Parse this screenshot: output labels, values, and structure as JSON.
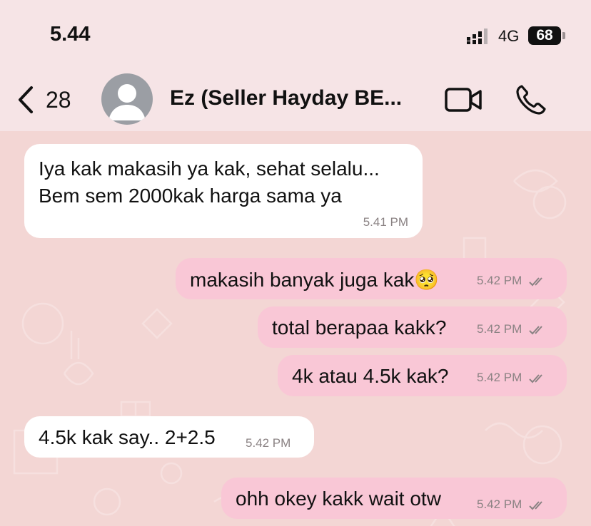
{
  "status_bar": {
    "time": "5.44",
    "network": "4G",
    "battery": "68"
  },
  "header": {
    "back_count": "28",
    "contact_name": "Ez (Seller Hayday BE..."
  },
  "messages": [
    {
      "direction": "in",
      "lines": [
        "Iya kak makasih ya kak, sehat selalu...",
        "Bem sem 2000kak harga sama ya"
      ],
      "time": "5.41 PM"
    },
    {
      "direction": "out",
      "text": "makasih banyak juga kak🥺",
      "time": "5.42 PM",
      "read": true
    },
    {
      "direction": "out",
      "text": "total berapaa kakk?",
      "time": "5.42 PM",
      "read": true
    },
    {
      "direction": "out",
      "text": "4k atau 4.5k kak?",
      "time": "5.42 PM",
      "read": true
    },
    {
      "direction": "in",
      "text": "4.5k kak say.. 2+2.5",
      "time": "5.42 PM"
    },
    {
      "direction": "out",
      "text": "ohh okey kakk wait otw",
      "time": "5.42 PM",
      "read": true
    }
  ],
  "colors": {
    "header_bg": "#f6e4e6",
    "chat_bg": "#f3d6d4",
    "incoming_bubble": "#ffffff",
    "outgoing_bubble": "#f9c7d6",
    "read_ticks": "#8a8283"
  },
  "icons": [
    "back-chevron-icon",
    "video-call-icon",
    "phone-call-icon",
    "default-avatar-icon",
    "signal-bars-icon",
    "read-ticks-icon"
  ]
}
